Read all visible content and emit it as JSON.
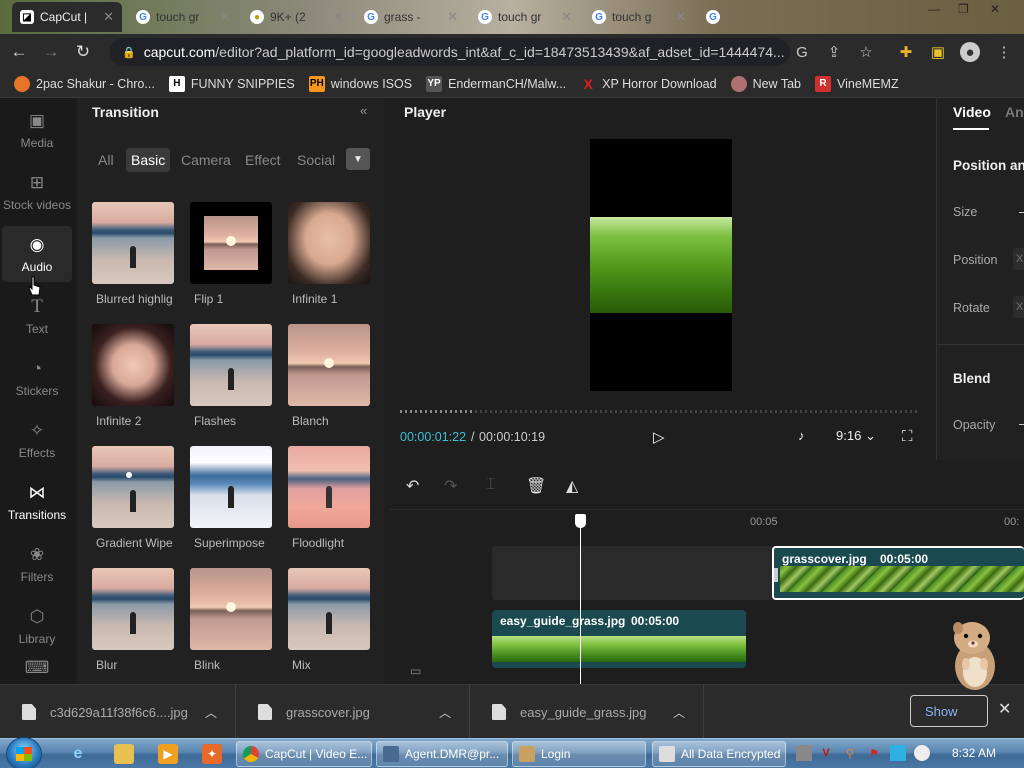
{
  "browser": {
    "tabs": [
      {
        "label": "CapCut |",
        "active": true
      },
      {
        "label": "touch gr",
        "active": false
      },
      {
        "label": "9K+ (2",
        "active": false
      },
      {
        "label": "grass -",
        "active": false
      },
      {
        "label": "touch gr",
        "active": false
      },
      {
        "label": "touch g",
        "active": false
      },
      {
        "label": "",
        "active": false
      }
    ],
    "url_host": "capcut.com",
    "url_path": "/editor?ad_platform_id=googleadwords_int&af_c_id=18473513439&af_adset_id=1444474...",
    "bookmarks": [
      {
        "label": "2pac Shakur - Chro...",
        "icon": "spotify-icon",
        "color": "#e8742a"
      },
      {
        "label": "FUNNY SNIPPIES",
        "icon": "h-icon",
        "color": "#ffffff"
      },
      {
        "label": "windows ISOS",
        "icon": "ph-icon",
        "color": "#f7971d"
      },
      {
        "label": "EndermanCH/Malw...",
        "icon": "yp-icon",
        "color": "#555555"
      },
      {
        "label": "XP Horror Download",
        "icon": "x-icon",
        "color": "#e02020"
      },
      {
        "label": "New Tab",
        "icon": "globe-icon",
        "color": "#b07070"
      },
      {
        "label": "VineMEMZ",
        "icon": "r-icon",
        "color": "#d03030"
      }
    ]
  },
  "capcut": {
    "nav": [
      {
        "label": "Media",
        "icon": "media-icon"
      },
      {
        "label": "Stock videos",
        "icon": "stock-icon"
      },
      {
        "label": "Audio",
        "icon": "audio-icon"
      },
      {
        "label": "Text",
        "icon": "text-icon"
      },
      {
        "label": "Stickers",
        "icon": "sticker-icon"
      },
      {
        "label": "Effects",
        "icon": "effects-icon"
      },
      {
        "label": "Transitions",
        "icon": "transitions-icon"
      },
      {
        "label": "Filters",
        "icon": "filters-icon"
      },
      {
        "label": "Library",
        "icon": "library-icon"
      }
    ],
    "transition_panel": {
      "title": "Transition",
      "categories": [
        "All",
        "Basic",
        "Camera",
        "Effect",
        "Social"
      ],
      "active_category": "Basic",
      "items": [
        {
          "label": "Blurred highlig",
          "style": "lake"
        },
        {
          "label": "Flip 1",
          "style": "flip"
        },
        {
          "label": "Infinite 1",
          "style": "face1"
        },
        {
          "label": "Infinite 2",
          "style": "face2"
        },
        {
          "label": "Flashes",
          "style": "lake"
        },
        {
          "label": "Blanch",
          "style": "sunset"
        },
        {
          "label": "Gradient Wipe",
          "style": "lake"
        },
        {
          "label": "Superimpose",
          "style": "blue"
        },
        {
          "label": "Floodlight",
          "style": "warm"
        },
        {
          "label": "Blur",
          "style": "lake"
        },
        {
          "label": "Blink",
          "style": "sunset"
        },
        {
          "label": "Mix",
          "style": "lake"
        }
      ]
    },
    "player": {
      "title": "Player",
      "current_time": "00:00:01:22",
      "separator": "/",
      "total_time": "00:00:10:19",
      "aspect": "9:16",
      "progress": 0.145
    },
    "properties": {
      "tabs": [
        "Video",
        "An"
      ],
      "section_title": "Position and",
      "fields": [
        "Size",
        "Position",
        "Rotate"
      ],
      "blend_title": "Blend",
      "opacity_label": "Opacity",
      "box_label": "X"
    },
    "timeline": {
      "ruler_mark": "00:05",
      "ruler_mark_right": "00:",
      "clips": [
        {
          "name": "grasscover.jpg",
          "duration": "00:05:00"
        },
        {
          "name": "easy_guide_grass.jpg",
          "duration": "00:05:00"
        }
      ]
    }
  },
  "downloads": {
    "items": [
      "c3d629a11f38f6c6....jpg",
      "grasscover.jpg",
      "easy_guide_grass.jpg"
    ],
    "show_all": "Show"
  },
  "taskbar": {
    "buttons": [
      "CapCut | Video E...",
      "Agent.DMR@pr...",
      "Login",
      "All Data Encrypted"
    ],
    "clock": "8:32 AM"
  }
}
